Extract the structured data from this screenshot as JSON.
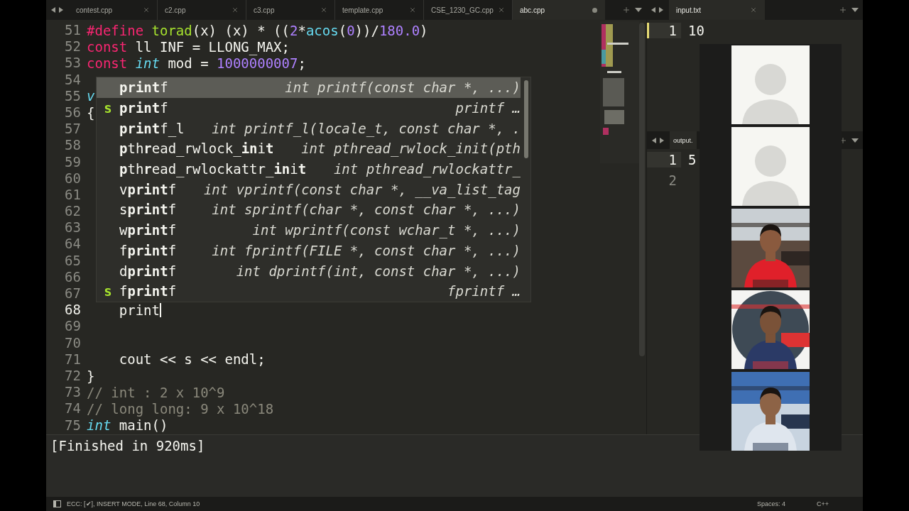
{
  "editor_tabs": [
    {
      "label": "contest.cpp",
      "selected": false,
      "modified": false
    },
    {
      "label": "c2.cpp",
      "selected": false,
      "modified": false
    },
    {
      "label": "c3.cpp",
      "selected": false,
      "modified": false
    },
    {
      "label": "template.cpp",
      "selected": false,
      "modified": false
    },
    {
      "label": "CSE_1230_GC.cpp",
      "selected": false,
      "modified": false
    },
    {
      "label": "abc.cpp",
      "selected": true,
      "modified": true
    }
  ],
  "code_lines": [
    {
      "number": "51",
      "current": false,
      "tokens": [
        {
          "text": "#define",
          "kind": "keyword"
        },
        {
          "text": " torad",
          "kind": "function"
        },
        {
          "text": "(x) (x) * ((",
          "kind": "plain"
        },
        {
          "text": "2",
          "kind": "number"
        },
        {
          "text": "*",
          "kind": "plain"
        },
        {
          "text": "acos",
          "kind": "builtin"
        },
        {
          "text": "(",
          "kind": "plain"
        },
        {
          "text": "0",
          "kind": "number"
        },
        {
          "text": "))/",
          "kind": "plain"
        },
        {
          "text": "180.0",
          "kind": "number"
        },
        {
          "text": ")",
          "kind": "plain"
        }
      ]
    },
    {
      "number": "52",
      "current": false,
      "tokens": [
        {
          "text": "const",
          "kind": "keyword"
        },
        {
          "text": " ll INF = LLONG_MAX;",
          "kind": "plain"
        }
      ]
    },
    {
      "number": "53",
      "current": false,
      "tokens": [
        {
          "text": "const",
          "kind": "keyword"
        },
        {
          "text": " int",
          "kind": "type"
        },
        {
          "text": " mod = ",
          "kind": "plain"
        },
        {
          "text": "1000000007",
          "kind": "number"
        },
        {
          "text": ";",
          "kind": "plain"
        }
      ]
    },
    {
      "number": "54",
      "current": false
    },
    {
      "number": "55",
      "current": false,
      "tokens": [
        {
          "text": "v",
          "kind": "type"
        }
      ]
    },
    {
      "number": "56",
      "current": false,
      "tokens": [
        {
          "text": "{",
          "kind": "plain"
        }
      ]
    },
    {
      "number": "57",
      "current": false
    },
    {
      "number": "58",
      "current": false
    },
    {
      "number": "59",
      "current": false
    },
    {
      "number": "60",
      "current": false
    },
    {
      "number": "61",
      "current": false
    },
    {
      "number": "62",
      "current": false
    },
    {
      "number": "63",
      "current": false
    },
    {
      "number": "64",
      "current": false
    },
    {
      "number": "65",
      "current": false
    },
    {
      "number": "66",
      "current": false
    },
    {
      "number": "67",
      "current": false
    },
    {
      "number": "68",
      "current": true,
      "tokens": [
        {
          "text": "    print",
          "kind": "plain"
        }
      ]
    },
    {
      "number": "69",
      "current": false
    },
    {
      "number": "70",
      "current": false
    },
    {
      "number": "71",
      "current": false,
      "tokens": [
        {
          "text": "    cout << s << endl;",
          "kind": "plain"
        }
      ]
    },
    {
      "number": "72",
      "current": false,
      "tokens": [
        {
          "text": "}",
          "kind": "plain"
        }
      ]
    },
    {
      "number": "73",
      "current": false,
      "tokens": [
        {
          "text": "// int : 2 x 10^9",
          "kind": "comment"
        }
      ]
    },
    {
      "number": "74",
      "current": false,
      "tokens": [
        {
          "text": "// long long: 9 x 10^18",
          "kind": "comment"
        }
      ]
    },
    {
      "number": "75",
      "current": false,
      "tokens": [
        {
          "text": "int",
          "kind": "type"
        },
        {
          "text": " main()",
          "kind": "plain"
        }
      ]
    }
  ],
  "completions": [
    {
      "name": "**print**f",
      "signature": "int printf(const char *, ...)",
      "selected": true
    },
    {
      "tag": "s",
      "name": "**print**f",
      "signature": "printf …",
      "selected": false
    },
    {
      "name": "**print**f_l",
      "signature": "int printf_l(locale_t, const char *, .",
      "selected": false
    },
    {
      "name": "**p**th**r**ead_rwlock_**in**i**t**",
      "signature": "int pthread_rwlock_init(pth",
      "selected": false
    },
    {
      "name": "**p**th**r**ead_rwlockattr_**in**i**t**",
      "signature": "int pthread_rwlockattr_",
      "selected": false
    },
    {
      "name": "v**print**f",
      "signature": "int vprintf(const char *, __va_list_tag",
      "selected": false
    },
    {
      "name": "s**print**f",
      "signature": "int sprintf(char *, const char *, ...)",
      "selected": false
    },
    {
      "name": "w**print**f",
      "signature": "int wprintf(const wchar_t *, ...)",
      "selected": false
    },
    {
      "name": "f**print**f",
      "signature": "int fprintf(FILE *, const char *, ...)",
      "selected": false
    },
    {
      "name": "d**print**f",
      "signature": "int dprintf(int, const char *, ...)",
      "selected": false
    },
    {
      "tag": "s",
      "name": "f**print**f",
      "signature": "fprintf …",
      "selected": false
    }
  ],
  "input_pane": {
    "tab": {
      "label": "input.txt",
      "selected": true
    },
    "lines": [
      {
        "number": "1",
        "text": "10"
      }
    ]
  },
  "output_pane": {
    "tab": {
      "label": "output.",
      "selected": true
    },
    "lines": [
      {
        "number": "1",
        "text": "5"
      },
      {
        "number": "2"
      }
    ]
  },
  "participants": [
    {
      "kind": "avatar"
    },
    {
      "kind": "avatar"
    },
    {
      "kind": "picture"
    },
    {
      "kind": "picture"
    },
    {
      "kind": "picture"
    }
  ],
  "build_output": "[Finished in 920ms]",
  "status_bar": {
    "left": "ECC: [✔], INSERT MODE, Line 68, Column 10",
    "spaces": "Spaces: 4",
    "syntax": "C++"
  }
}
